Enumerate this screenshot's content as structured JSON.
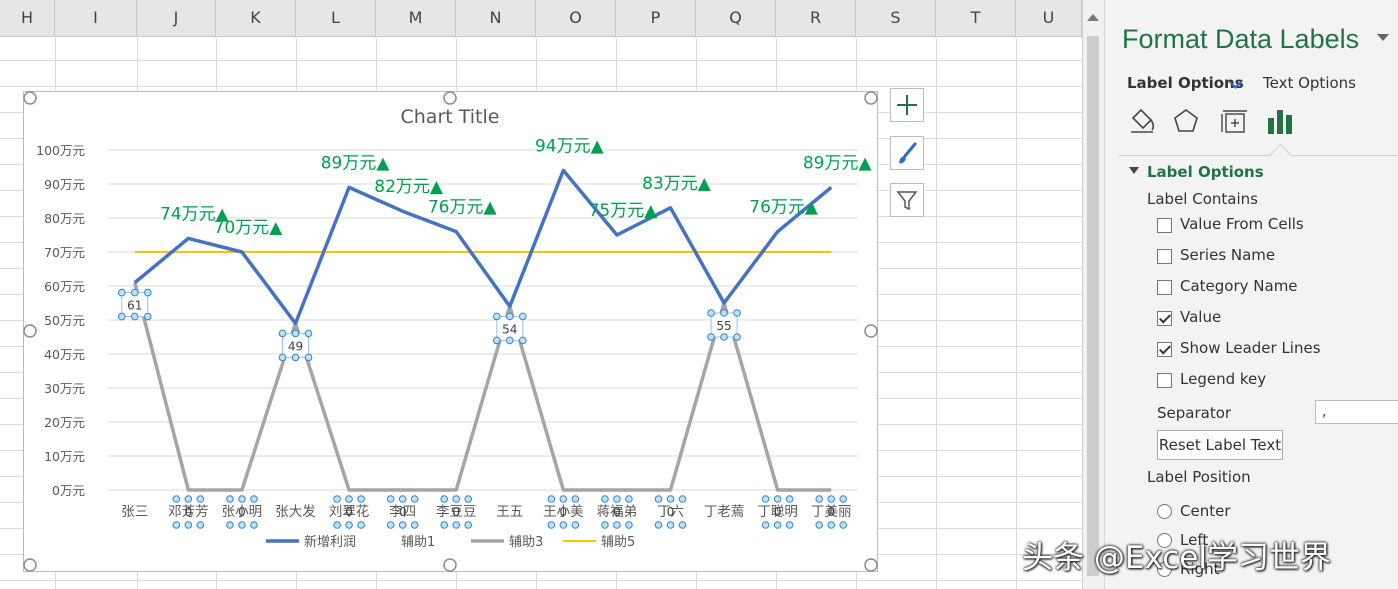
{
  "spreadsheet": {
    "columns": [
      "H",
      "I",
      "J",
      "K",
      "L",
      "M",
      "N",
      "O",
      "P",
      "Q",
      "R",
      "S",
      "T",
      "U"
    ]
  },
  "chart_data": {
    "type": "line",
    "title": "Chart Title",
    "categories": [
      "张三",
      "邓芳芳",
      "张小明",
      "张大发",
      "刘翠花",
      "李四",
      "李豆豆",
      "王五",
      "王小美",
      "蒋福弟",
      "丁六",
      "丁老蔫",
      "丁聪明",
      "丁美丽"
    ],
    "y_ticks": [
      "0万元",
      "10万元",
      "20万元",
      "30万元",
      "40万元",
      "50万元",
      "60万元",
      "70万元",
      "80万元",
      "90万元",
      "100万元"
    ],
    "ylim": [
      0,
      100
    ],
    "grid": true,
    "legend_placement": "bottom",
    "series": [
      {
        "name": "新增利润",
        "color": "#4472c4",
        "values": [
          61,
          74,
          70,
          49,
          89,
          82,
          76,
          54,
          94,
          75,
          83,
          55,
          76,
          89
        ],
        "labels": [
          "",
          "74万元▲",
          "70万元▲",
          "",
          "89万元▲",
          "82万元▲",
          "76万元▲",
          "",
          "94万元▲",
          "75万元▲",
          "83万元▲",
          "",
          "76万元▲",
          "89万元▲"
        ],
        "label_color": "#00a050"
      },
      {
        "name": "辅助1",
        "color": "#ffffff",
        "values": [
          61,
          null,
          null,
          49,
          null,
          null,
          null,
          54,
          null,
          null,
          null,
          55,
          null,
          null
        ],
        "labels": [
          "61",
          "",
          "",
          "49",
          "",
          "",
          "",
          "54",
          "",
          "",
          "",
          "55",
          "",
          ""
        ]
      },
      {
        "name": "辅助3",
        "color": "#a5a5a5",
        "values": [
          61,
          0,
          0,
          49,
          0,
          0,
          0,
          54,
          0,
          0,
          0,
          55,
          0,
          0
        ],
        "labels": [
          "",
          "0",
          "0",
          "",
          "0",
          "0",
          "0",
          "",
          "0",
          "0",
          "0",
          "",
          "0",
          "0"
        ]
      },
      {
        "name": "辅助5",
        "color": "#ffc000",
        "values": [
          70,
          70,
          70,
          70,
          70,
          70,
          70,
          70,
          70,
          70,
          70,
          70,
          70,
          70
        ]
      }
    ]
  },
  "chart_side_buttons": [
    "plus-icon",
    "brush-icon",
    "filter-icon"
  ],
  "panel": {
    "title": "Format Data Labels",
    "tabs": {
      "label_options": "Label Options",
      "text_options": "Text Options"
    },
    "section_title": "Label Options",
    "label_contains": "Label Contains",
    "checkboxes": [
      {
        "label": "Value From Cells",
        "checked": false
      },
      {
        "label": "Series Name",
        "checked": false
      },
      {
        "label": "Category Name",
        "checked": false
      },
      {
        "label": "Value",
        "checked": true
      },
      {
        "label": "Show Leader Lines",
        "checked": true
      },
      {
        "label": "Legend key",
        "checked": false
      }
    ],
    "separator_label": "Separator",
    "separator_value": ",",
    "reset_button": "Reset Label Text",
    "label_position": "Label Position",
    "positions": [
      "Center",
      "Left",
      "Right"
    ]
  },
  "watermark": "头条 @Excel学习世界"
}
